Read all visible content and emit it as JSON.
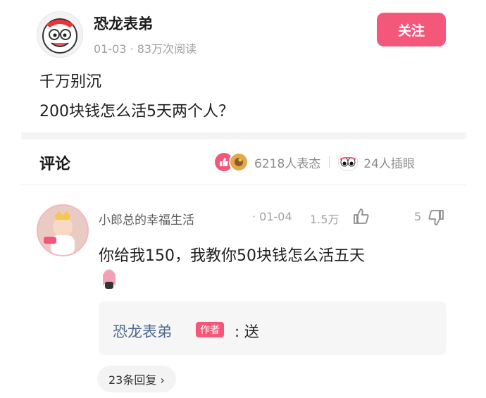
{
  "post": {
    "author_name": "恐龙表弟",
    "meta": "01-03 · 83万次阅读",
    "follow_label": "关注",
    "content_lines": [
      "千万别沉",
      "200块钱怎么活5天两个人？"
    ]
  },
  "comments_header": {
    "title": "评论",
    "reactions_label": "6218人表态",
    "plugs_label": "24人插眼"
  },
  "comment": {
    "user": "小郎总的幸福生活",
    "date": "· 01-04",
    "likes": "1.5万",
    "dislikes": "5",
    "text": "你给我150，我教你50块钱怎么活五天",
    "reply": {
      "author": "恐龙表弟",
      "tag": "作者",
      "text": ": 送"
    },
    "replies_count": "23条回复 ›"
  },
  "colors": {
    "accent": "#f5577a",
    "reply_author": "#4b6a93",
    "muted": "#a0a0a0"
  },
  "icons": [
    "cartoon-avatar-icon",
    "like-icon",
    "emoji-reaction-icon",
    "eyes-icon",
    "thumb-up-icon",
    "thumb-down-icon",
    "sticker-icon"
  ]
}
